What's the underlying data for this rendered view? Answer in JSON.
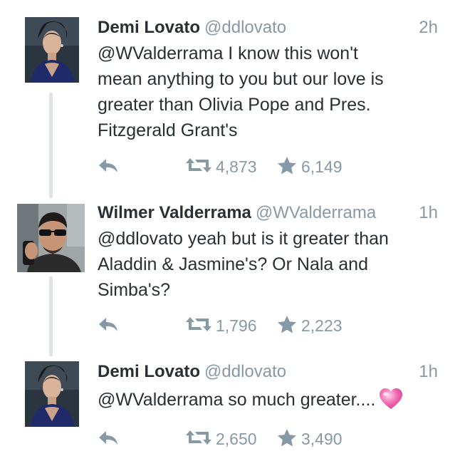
{
  "tweets": [
    {
      "display_name": "Demi Lovato",
      "handle": "@ddlovato",
      "time": "2h",
      "text_lines": [
        "@WValderrama I know this won't",
        "mean anything to you but our love is",
        "greater than Olivia Pope and Pres.",
        "Fitzgerald Grant's"
      ],
      "retweets": "4,873",
      "favorites": "6,149"
    },
    {
      "display_name": "Wilmer Valderrama",
      "handle": "@WValderrama",
      "time": "1h",
      "text_lines": [
        "@ddlovato yeah but is it greater than",
        "Aladdin & Jasmine's? Or Nala and",
        "Simba's?"
      ],
      "retweets": "1,796",
      "favorites": "2,223"
    },
    {
      "display_name": "Demi Lovato",
      "handle": "@ddlovato",
      "time": "1h",
      "text_lines": [
        "@WValderrama so much greater...."
      ],
      "retweets": "2,650",
      "favorites": "3,490"
    }
  ],
  "icons": {
    "reply": "reply-icon",
    "retweet": "retweet-icon",
    "favorite": "star-icon",
    "emoji": "pink-heart-emoji"
  },
  "colors": {
    "text": "#292f33",
    "muted": "#8899a6",
    "thread_line": "#dfe3e6",
    "heart": "#f06ab0"
  }
}
